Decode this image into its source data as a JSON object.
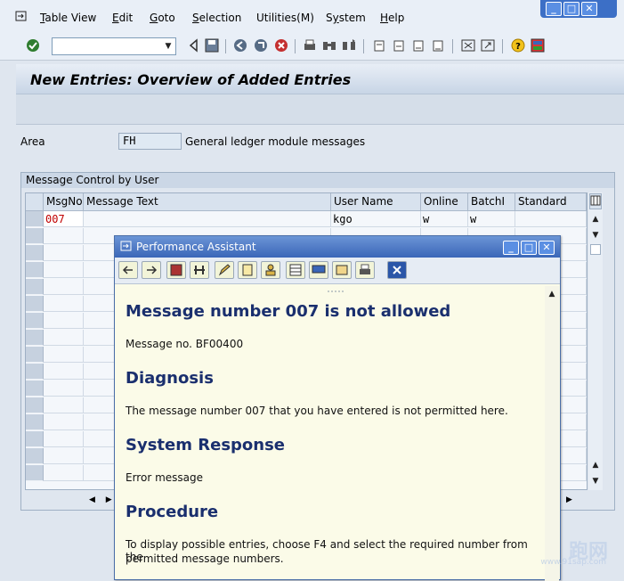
{
  "menu": {
    "items": [
      {
        "label": "Table View",
        "ul": "T"
      },
      {
        "label": "Edit",
        "ul": "E"
      },
      {
        "label": "Goto",
        "ul": "G"
      },
      {
        "label": "Selection",
        "ul": "S"
      },
      {
        "label": "Utilities(M)",
        "ul": ""
      },
      {
        "label": "System",
        "ul": "y"
      },
      {
        "label": "Help",
        "ul": "H"
      }
    ]
  },
  "page": {
    "title": "New Entries: Overview of Added Entries"
  },
  "area": {
    "label": "Area",
    "value": "FH",
    "description": "General ledger module messages"
  },
  "group": {
    "title": "Message Control by User"
  },
  "table": {
    "columns": [
      "MsgNo",
      "Message Text",
      "User Name",
      "Online",
      "BatchI",
      "Standard"
    ],
    "rows": [
      {
        "msgno": "007",
        "text": "",
        "user": "kgo",
        "online": "w",
        "batch": "w",
        "standard": ""
      }
    ]
  },
  "dialog": {
    "title": "Performance Assistant",
    "heading_main": "Message number 007 is not allowed",
    "message_no": "Message no. BF00400",
    "heading_diagnosis": "Diagnosis",
    "diagnosis_text": "The message number 007 that you have entered is not permitted here.",
    "heading_response": "System Response",
    "response_text": "Error message",
    "heading_procedure": "Procedure",
    "procedure_line1": "To display possible entries, choose F4 and select the required number from the",
    "procedure_line2": "permitted message numbers."
  },
  "watermark": {
    "text": "跑网",
    "sub": "www.91sap.com"
  },
  "colors": {
    "accent": "#3a66b8",
    "dialog_bg": "#fbfbe8",
    "heading": "#1a2f6e",
    "error_value": "#c00000"
  }
}
